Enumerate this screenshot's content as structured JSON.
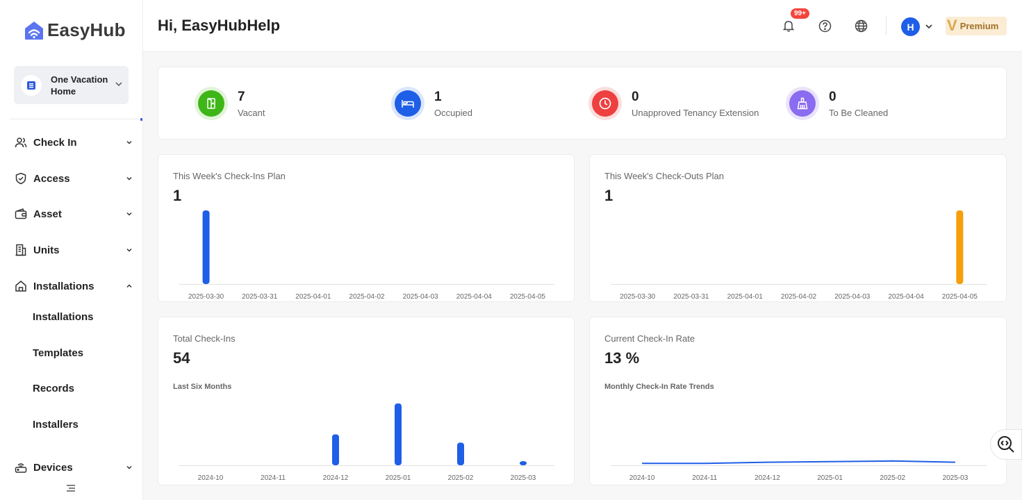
{
  "app": {
    "name": "EasyHub"
  },
  "property": {
    "name": "One Vacation Home"
  },
  "nav": [
    {
      "label": "Check In",
      "icon": "users-icon"
    },
    {
      "label": "Access",
      "icon": "shield-icon"
    },
    {
      "label": "Asset",
      "icon": "wallet-icon"
    },
    {
      "label": "Units",
      "icon": "building-icon"
    },
    {
      "label": "Installations",
      "icon": "wrench-icon",
      "expanded": true
    },
    {
      "label": "Devices",
      "icon": "router-icon"
    }
  ],
  "installations_sub": [
    "Installations",
    "Templates",
    "Records",
    "Installers"
  ],
  "header": {
    "greeting": "Hi, EasyHubHelp",
    "notifications_badge": "99+",
    "avatar_initial": "H",
    "plan_mark": "V",
    "plan": "Premium"
  },
  "stats": [
    {
      "value": "7",
      "label": "Vacant",
      "icon": "door-icon",
      "color": "#3fb618"
    },
    {
      "value": "1",
      "label": "Occupied",
      "icon": "bed-icon",
      "color": "#1f5ee6"
    },
    {
      "value": "0",
      "label": "Unapproved Tenancy Extension",
      "icon": "clock-icon",
      "color": "#ee4040"
    },
    {
      "value": "0",
      "label": "To Be Cleaned",
      "icon": "broom-icon",
      "color": "#8a6cf0"
    }
  ],
  "charts": {
    "checkins_week": {
      "title": "This Week's Check-Ins Plan",
      "total": "1"
    },
    "checkouts_week": {
      "title": "This Week's Check-Outs Plan",
      "total": "1"
    },
    "total_checkins": {
      "title": "Total Check-Ins",
      "total": "54",
      "subtitle": "Last Six Months"
    },
    "checkin_rate": {
      "title": "Current Check-In Rate",
      "total": "13 %",
      "subtitle": "Monthly Check-In Rate Trends"
    }
  },
  "chart_data": [
    {
      "type": "bar",
      "categories": [
        "2025-03-30",
        "2025-03-31",
        "2025-04-01",
        "2025-04-02",
        "2025-04-03",
        "2025-04-04",
        "2025-04-05"
      ],
      "values": [
        1,
        0,
        0,
        0,
        0,
        0,
        0
      ],
      "color": "#1f5ee6"
    },
    {
      "type": "bar",
      "categories": [
        "2025-03-30",
        "2025-03-31",
        "2025-04-01",
        "2025-04-02",
        "2025-04-03",
        "2025-04-04",
        "2025-04-05"
      ],
      "values": [
        0,
        0,
        0,
        0,
        0,
        0,
        1
      ],
      "color": "#f59f0b"
    },
    {
      "type": "bar",
      "categories": [
        "2024-10",
        "2024-11",
        "2024-12",
        "2025-01",
        "2025-02",
        "2025-03"
      ],
      "values": [
        0,
        0,
        15,
        30,
        11,
        2
      ],
      "color": "#1f5ee6"
    },
    {
      "type": "line",
      "categories": [
        "2024-10",
        "2024-11",
        "2024-12",
        "2025-01",
        "2025-02",
        "2025-03"
      ],
      "values": [
        3,
        3,
        5,
        6,
        7,
        5
      ],
      "ylim": [
        0,
        100
      ],
      "color": "#1f5ee6"
    }
  ]
}
